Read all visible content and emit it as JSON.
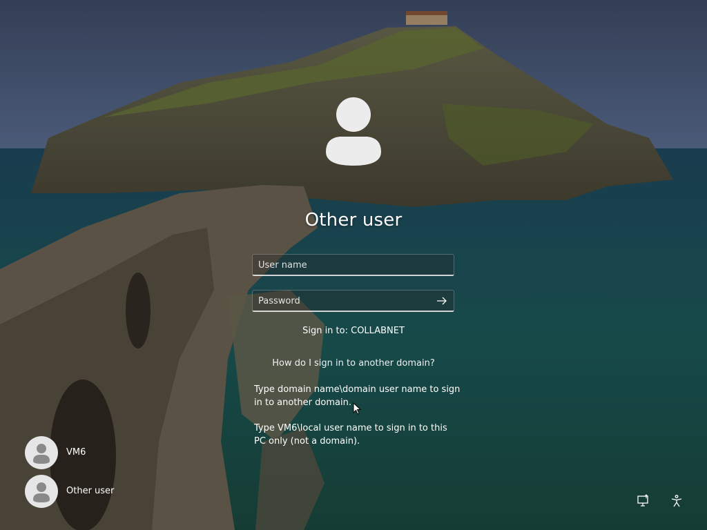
{
  "login": {
    "title": "Other user",
    "username_placeholder": "User name",
    "password_placeholder": "Password",
    "sign_in_to": "Sign in to: COLLABNET",
    "help_link": "How do I sign in to another domain?",
    "help_text_1": "Type domain name\\domain user name to sign in to another domain.",
    "help_text_2": "Type VM6\\local user name to sign in to this PC only (not a domain)."
  },
  "users": [
    {
      "name": "VM6"
    },
    {
      "name": "Other user"
    }
  ],
  "icons": {
    "submit": "arrow-right-icon",
    "network": "network-icon",
    "accessibility": "accessibility-icon",
    "avatar": "user-avatar-icon"
  },
  "colors": {
    "text": "#ffffff",
    "avatar_fill": "#e6e6e6",
    "avatar_glyph": "#8a8a8a"
  }
}
